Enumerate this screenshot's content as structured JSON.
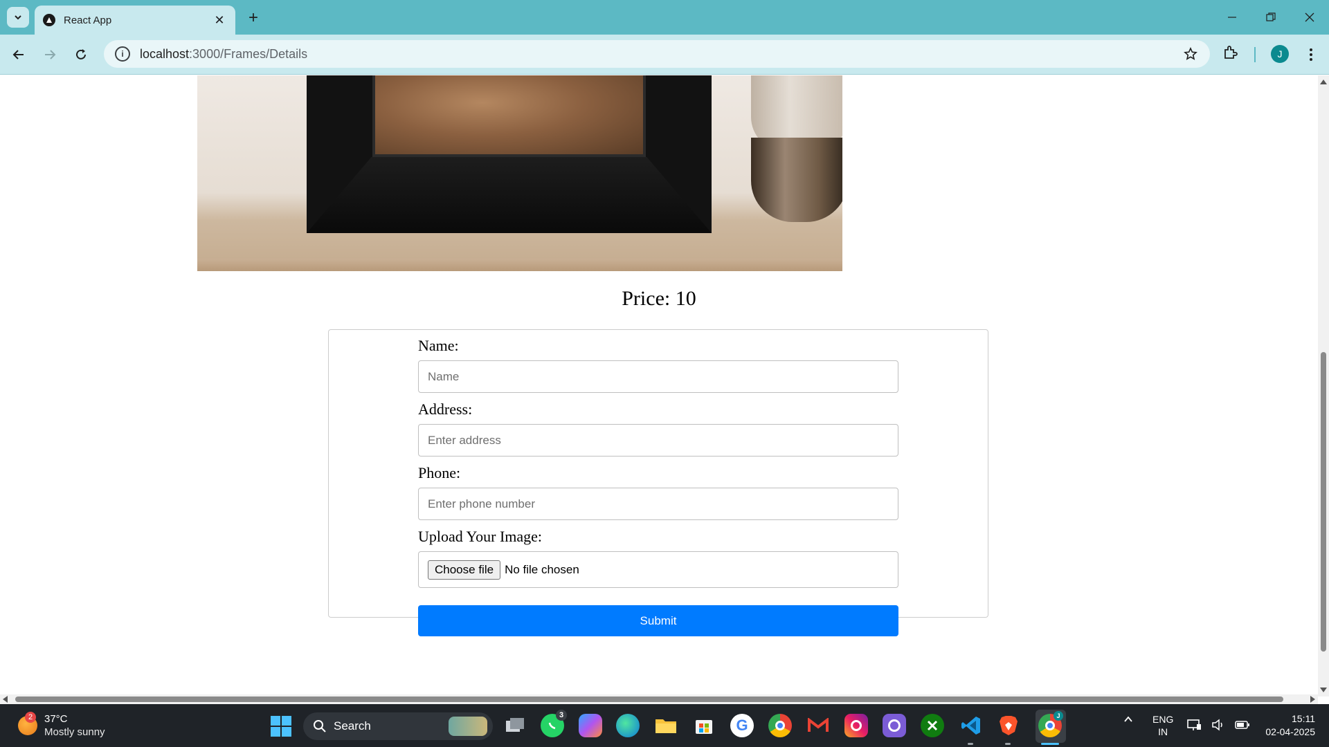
{
  "browser": {
    "tab_title": "React App",
    "url_host": "localhost",
    "url_path": ":3000/Frames/Details",
    "profile_initial": "J"
  },
  "page": {
    "price_text": "Price: 10",
    "form": {
      "name_label": "Name:",
      "name_placeholder": "Name",
      "address_label": "Address:",
      "address_placeholder": "Enter address",
      "phone_label": "Phone:",
      "phone_placeholder": "Enter phone number",
      "image_label": "Upload Your Image:",
      "file_button": "Choose file",
      "file_status": "No file chosen",
      "submit_label": "Submit"
    },
    "colors": {
      "submit_bg": "#007bff",
      "titlebar": "#5cb9c4"
    }
  },
  "taskbar": {
    "weather_badge": "2",
    "weather_temp": "37°C",
    "weather_desc": "Mostly sunny",
    "search_label": "Search",
    "whatsapp_badge": "3",
    "lang_primary": "ENG",
    "lang_region": "IN",
    "time": "15:11",
    "date": "02-04-2025"
  }
}
